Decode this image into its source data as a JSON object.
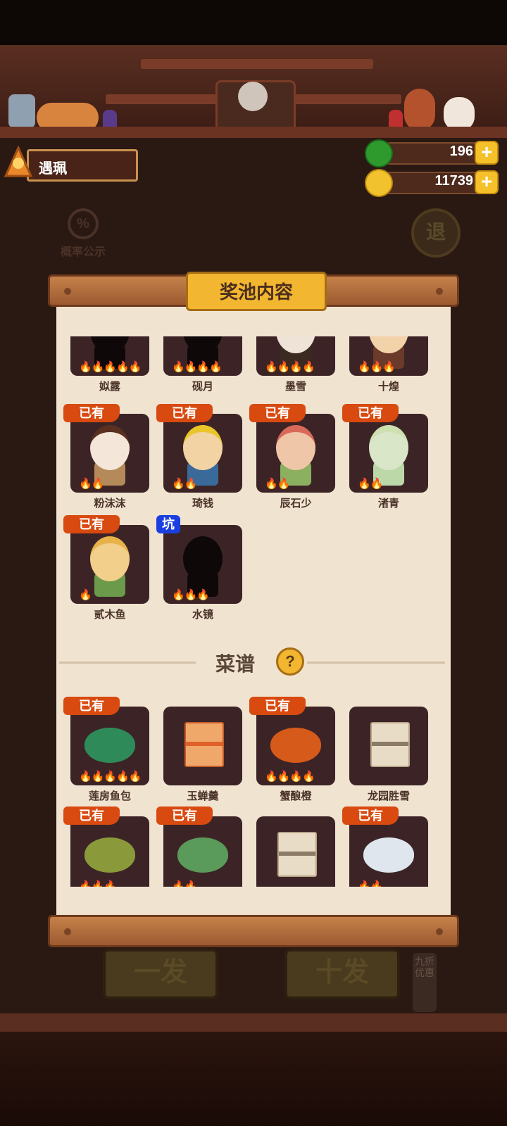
{
  "player": {
    "name": "遇珮"
  },
  "currency": {
    "jade": "196",
    "coins": "11739",
    "plus": "+"
  },
  "hud": {
    "probability_symbol": "%",
    "probability_label": "概率公示",
    "exit_label": "退"
  },
  "pull_buttons": {
    "single": "一发",
    "ten": "十发",
    "discount": "九折优惠"
  },
  "modal": {
    "title": "奖池内容"
  },
  "characters": [
    {
      "name": "姒露",
      "flames": 5,
      "owned": false,
      "silhouette": true
    },
    {
      "name": "砚月",
      "flames": 4,
      "owned": false,
      "silhouette": true
    },
    {
      "name": "墨雪",
      "flames": 4,
      "owned": false,
      "silhouette": false
    },
    {
      "name": "十煌",
      "flames": 3,
      "owned": false,
      "silhouette": false
    },
    {
      "name": "粉沫沫",
      "flames": 2,
      "owned": true,
      "badge": "已有",
      "silhouette": false
    },
    {
      "name": "琦钱",
      "flames": 2,
      "owned": true,
      "badge": "已有",
      "silhouette": false
    },
    {
      "name": "辰石少",
      "flames": 2,
      "owned": true,
      "badge": "已有",
      "silhouette": false
    },
    {
      "name": "渚青",
      "flames": 2,
      "owned": true,
      "badge": "已有",
      "silhouette": false
    },
    {
      "name": "贰木鱼",
      "flames": 1,
      "owned": true,
      "badge": "已有",
      "silhouette": false
    },
    {
      "name": "水镜",
      "flames": 3,
      "owned": false,
      "badge": "坑",
      "silhouette": true
    }
  ],
  "recipes_section": {
    "title": "菜谱",
    "help": "?"
  },
  "recipes": [
    {
      "name": "莲房鱼包",
      "flames": 5,
      "owned": true,
      "badge": "已有"
    },
    {
      "name": "玉蝉羹",
      "flames": 0,
      "owned": false
    },
    {
      "name": "蟹酿橙",
      "flames": 4,
      "owned": true,
      "badge": "已有"
    },
    {
      "name": "龙园胜雪",
      "flames": 0,
      "owned": false
    },
    {
      "name": "",
      "flames": 3,
      "owned": true,
      "badge": "已有"
    },
    {
      "name": "",
      "flames": 2,
      "owned": true,
      "badge": "已有"
    },
    {
      "name": "",
      "flames": 0,
      "owned": false
    },
    {
      "name": "",
      "flames": 2,
      "owned": true,
      "badge": "已有"
    }
  ]
}
